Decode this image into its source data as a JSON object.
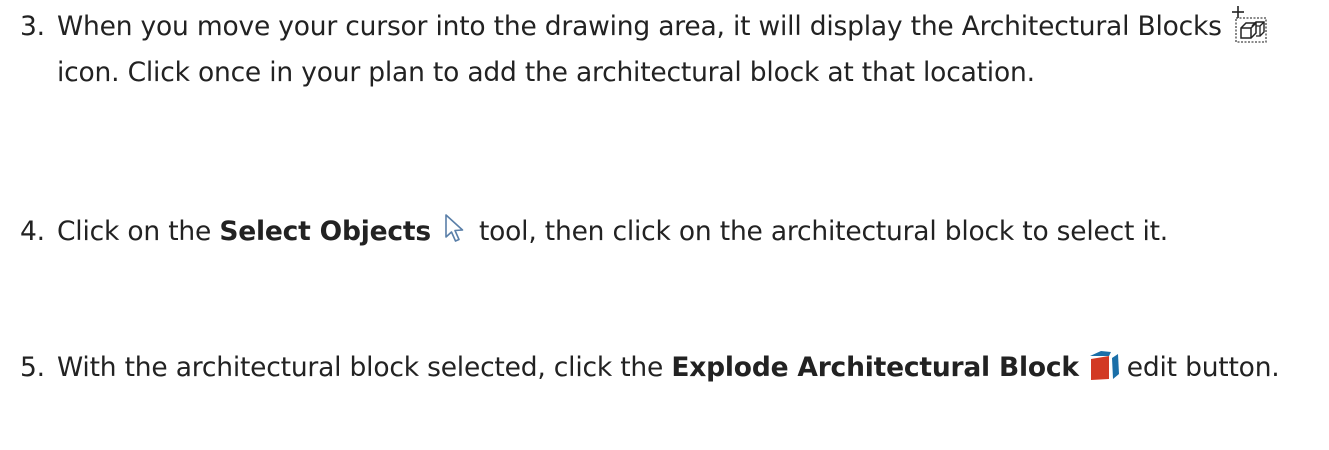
{
  "steps": [
    {
      "number": "3.",
      "text_a": "When you move your cursor into the drawing area, it will display the Architectural Blocks",
      "icon": "architectural-blocks-icon",
      "text_b": "icon. Click once in your plan to add the architectural block at that location."
    },
    {
      "number": "4.",
      "text_a": "Click on the",
      "bold": "Select Objects",
      "icon": "select-objects-icon",
      "text_b": "tool, then click on the architectural block to select it."
    },
    {
      "number": "5.",
      "text_a": "With the architectural block selected, click the",
      "bold": "Explode Architectural Block",
      "icon": "explode-architectural-block-icon",
      "text_b": "edit button."
    }
  ],
  "colors": {
    "text": "#222222",
    "explode_red": "#d23a24",
    "explode_blue": "#1b6fa8"
  }
}
